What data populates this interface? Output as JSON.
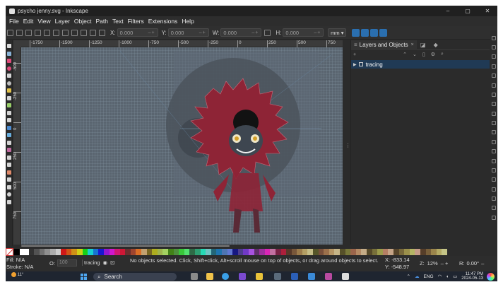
{
  "window": {
    "title": "psycho jenny.svg - Inkscape",
    "controls": [
      "–",
      "▢",
      "✕"
    ]
  },
  "menu": [
    "File",
    "Edit",
    "View",
    "Layer",
    "Object",
    "Path",
    "Text",
    "Filters",
    "Extensions",
    "Help"
  ],
  "toolbar": {
    "x_label": "X:",
    "x_value": "0.000",
    "y_label": "Y:",
    "y_value": "0.000",
    "w_label": "W:",
    "w_value": "0.000",
    "h_label": "H:",
    "h_value": "0.000",
    "stepper": "–+",
    "unit": "mm"
  },
  "ruler": {
    "h_ticks": [
      "-1750",
      "-1500",
      "-1250",
      "-1000",
      "-750",
      "-500",
      "-250",
      "0",
      "250",
      "500",
      "750"
    ],
    "v_ticks": [
      "-500",
      "-250",
      "0",
      "250",
      "500",
      "750"
    ]
  },
  "panel": {
    "tab_label": "Layers and Objects",
    "tab_close": "×",
    "layers": [
      {
        "name": "tracing",
        "selected": true
      }
    ]
  },
  "status": {
    "fill_label": "Fill:",
    "fill_value": "N/A",
    "stroke_label": "Stroke:",
    "stroke_value": "N/A",
    "opacity_label": "O:",
    "opacity_value": "100",
    "current_layer": "tracing",
    "message": "No objects selected. Click, Shift+click, Alt+scroll mouse on top of objects, or drag around objects to select.",
    "cursor_x_label": "X:",
    "cursor_x": "-833.14",
    "cursor_y_label": "Y:",
    "cursor_y": "-548.97",
    "zoom_label": "Z:",
    "zoom": "12%",
    "rotation_label": "R:",
    "rotation": "0.00°"
  },
  "taskbar": {
    "weather_temp": "11°",
    "search_label": "Search",
    "language": "ENG",
    "time": "11:47 PM",
    "date": "2024-05-13"
  },
  "colors": {
    "canvas": "#5a6570",
    "artwork_red": "#8e2436",
    "accent_blue": "#2a6fb0",
    "panel_selection": "#203a55"
  }
}
